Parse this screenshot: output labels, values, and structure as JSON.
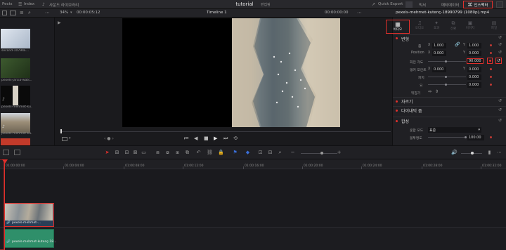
{
  "topbar": {
    "left_item_1": "Pects",
    "left_item_2": "Index",
    "left_item_3": "사운드 라이브러리",
    "project_title": "tutorial",
    "project_status": "편집됨",
    "quick_export": "Quick Export",
    "mixer": "믹서",
    "metadata": "메타데이터",
    "inspector": "인스펙터"
  },
  "viewerbar": {
    "zoom": "34%",
    "timecode": "00:00:05:12",
    "timeline_name": "Timeline 1",
    "current_tc": "00:00:00:00",
    "clip_name": "pexels-mehmet-kutenç-18990799 (1080p).mp4"
  },
  "mediapool": {
    "items": [
      {
        "label": "second-10794E..."
      },
      {
        "label": "pexels-jarcia-watc..."
      },
      {
        "label": "pexels-mehmet-ku..."
      },
      {
        "label": "pexels-mehmet-ku..."
      }
    ]
  },
  "inspector": {
    "tabs": [
      "비디오",
      "오디오",
      "효과",
      "전환",
      "이미지",
      "파일"
    ],
    "transform_title": "변형",
    "zoom_label": "줌",
    "zoom_x": "1.000",
    "zoom_y": "1.000",
    "position_label": "Position",
    "position_x": "0.000",
    "position_y": "0.000",
    "rotation_label": "회전 각도",
    "rotation_value": "90.000",
    "anchor_label": "앵커 포인트",
    "anchor_x": "0.000",
    "anchor_y": "0.000",
    "pitch_label": "피치",
    "pitch_value": "0.000",
    "yaw_label": "요",
    "yaw_value": "0.000",
    "flip_label": "뒤집기",
    "crop_title": "자르기",
    "dynamic_zoom_title": "다이내믹 줌",
    "composite_title": "합성",
    "composite_mode_label": "혼합 모드",
    "composite_mode_value": "표준",
    "opacity_label": "불투명도",
    "opacity_value": "100.00"
  },
  "timeline": {
    "timecodes": [
      "01:00:00:00",
      "01:00:04:00",
      "01:00:08:00",
      "01:00:12:00",
      "01:00:16:00",
      "01:00:20:00",
      "01:00:24:00",
      "01:00:28:00",
      "01:00:32:00"
    ],
    "video_clip_label": "pexels-mehmet-...",
    "audio_clip_label": "pexels-mehmet-kutenç-18..."
  },
  "colors": {
    "accent_red": "#e0302c",
    "audio_clip": "#2f8f6a",
    "flag_blue": "#3a6fd8"
  }
}
